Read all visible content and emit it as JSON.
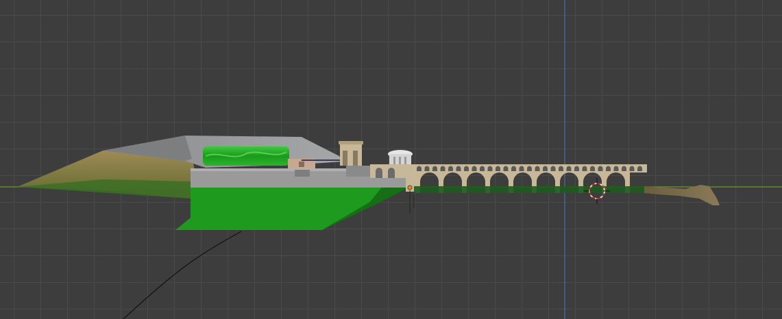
{
  "viewport": {
    "background_color": "#3d3d3d",
    "grid_line_color": "#4a4a4a",
    "x_axis_color": "#6a9a2e",
    "z_axis_color": "#4a6fa8",
    "selection_outline_color": "#e88a2e"
  },
  "scene": {
    "terrain_color": "#1e9a1e",
    "terrain_dark_color": "#157015",
    "stone_color": "#c8b89a",
    "concrete_color": "#9a9a9a",
    "roof_color": "#8f9092",
    "hill_color": "#7d6a45",
    "cursor_colors": [
      "#d8d8d8",
      "#c82424"
    ]
  }
}
